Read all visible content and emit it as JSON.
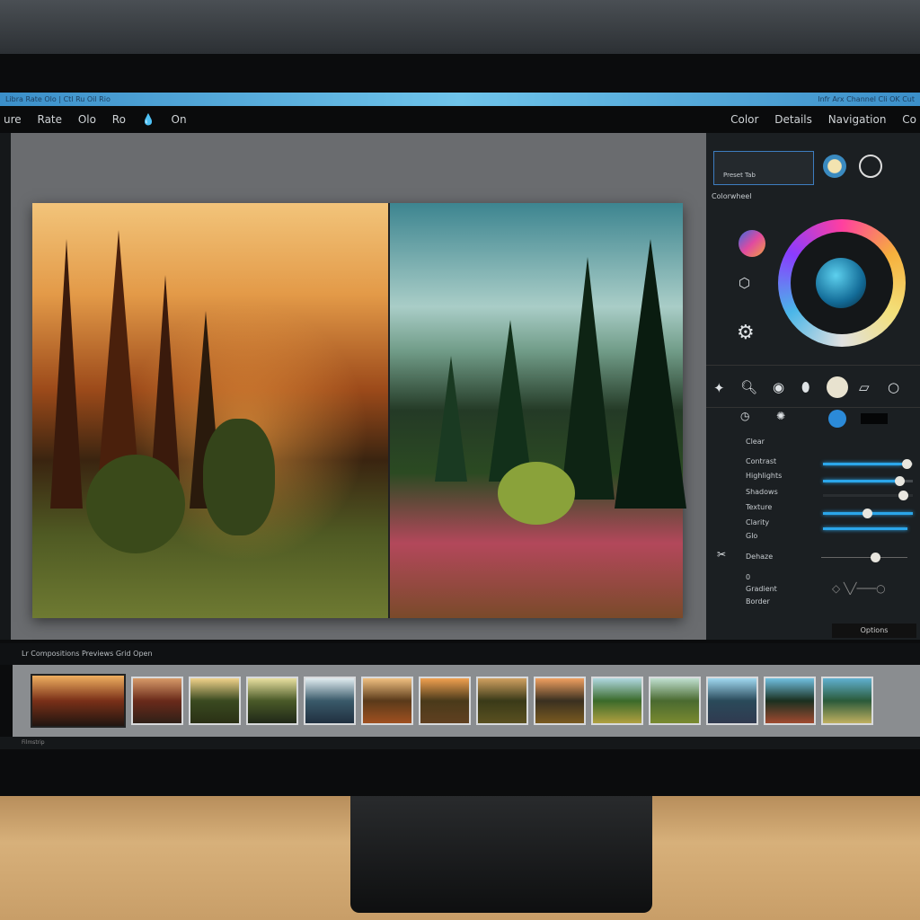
{
  "window": {
    "title_left": "Libra Rate Olo | Ctl Ru Oil Rio",
    "title_right": "Infr Arx Channel Cli OK Cut"
  },
  "menu": {
    "left": [
      "ure",
      "Rate",
      "Olo",
      "Ro",
      "On"
    ],
    "right": [
      "Color",
      "Details",
      "Navigation",
      "Co"
    ]
  },
  "panel": {
    "preset_field": "Preset Tab",
    "section_label": "Colorwheel",
    "rows": [
      {
        "label": "Clear",
        "value": null
      },
      {
        "label": "Contrast",
        "value": 0.88
      },
      {
        "label": "Highlights",
        "value": 0.85
      },
      {
        "label": "Shadows",
        "value": 0.84
      },
      {
        "label": "Texture",
        "value": 0.5
      },
      {
        "label": "Clarity",
        "value": 0.89
      },
      {
        "label": "Glo",
        "value": null
      },
      {
        "label": "Dehaze",
        "value": 0.56
      }
    ],
    "curve_labels": [
      "0",
      "Gradient",
      "Border"
    ],
    "footer_button": "Options"
  },
  "filmstrip": {
    "header": "Lr Compositions  Previews Grid  Open",
    "footer": "Filmstrip",
    "thumbs": [
      [
        "#f0b060",
        "#7a3018",
        "#201510"
      ],
      [
        "#d79a68",
        "#6a2a1a",
        "#302018"
      ],
      [
        "#f0d28a",
        "#3a4a20",
        "#2a3015"
      ],
      [
        "#e8e0a0",
        "#4a5a28",
        "#202818"
      ],
      [
        "#e0ecf0",
        "#3a5a6a",
        "#203040"
      ],
      [
        "#f0c080",
        "#5a3a1a",
        "#a05020"
      ],
      [
        "#f0a050",
        "#4a3a1a",
        "#604020"
      ],
      [
        "#d0a060",
        "#3a3a18",
        "#5a5020"
      ],
      [
        "#f0a060",
        "#3a3020",
        "#7a5a20"
      ],
      [
        "#b0d8e0",
        "#3a6a2a",
        "#b0a040"
      ],
      [
        "#c0e0d0",
        "#4a6a30",
        "#7a8a30"
      ],
      [
        "#a0d8f0",
        "#2a4a5a",
        "#303a50"
      ],
      [
        "#70c0e0",
        "#1a3020",
        "#a04a30"
      ],
      [
        "#60b0d0",
        "#2a5a3a",
        "#c0b060"
      ]
    ]
  },
  "colors": {
    "accent": "#2ba6ea",
    "titlebar": "#5cb6e0"
  }
}
